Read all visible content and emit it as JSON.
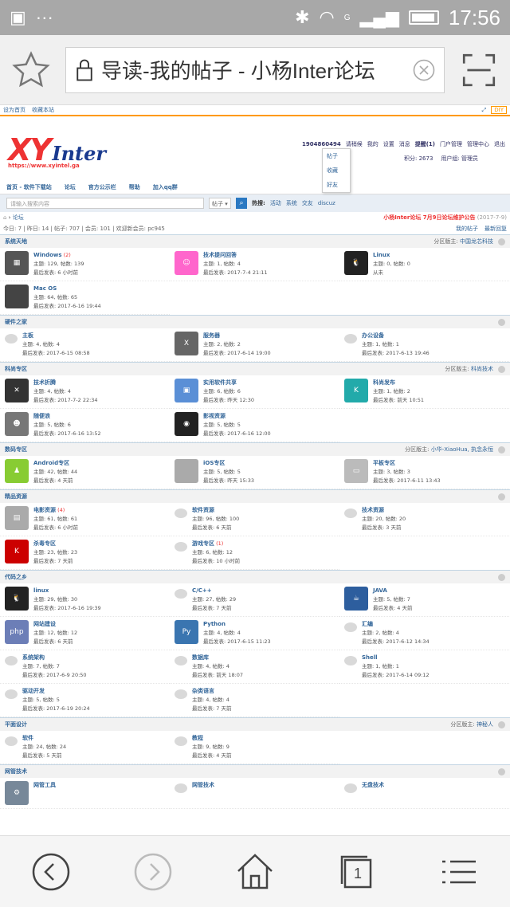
{
  "status": {
    "time": "17:56",
    "dots": "···",
    "net": "G"
  },
  "browser": {
    "title": "导读-我的帖子 - 小杨Inter论坛",
    "tab_count": "1"
  },
  "page": {
    "top_left": [
      "设为首页",
      "收藏本站"
    ],
    "top_right": "DIY",
    "logo": {
      "xy": "XY",
      "inter": "Inter",
      "url": "https://www.xyintel.ga"
    },
    "user": {
      "id": "1904860494",
      "items": [
        "请稍候",
        "我的",
        "设置",
        "消息",
        "提醒(1)",
        "门户管理",
        "管理中心",
        "退出"
      ],
      "points": "积分: 2673",
      "group": "用户组: 管理员"
    },
    "dropdown": [
      "帖子",
      "收藏",
      "好友"
    ],
    "nav": [
      "首页 - 软件下载站",
      "论坛",
      "官方公示栏",
      "帮助",
      "加入qq群"
    ],
    "search": {
      "placeholder": "请输入搜索内容",
      "type": "帖子",
      "hot_label": "热搜:",
      "hot": [
        "活动",
        "系统",
        "交友",
        "discuz"
      ]
    },
    "crumb": {
      "home": "论坛",
      "notice": "小杨Inter论坛 7月9日论坛维护公告",
      "date": "(2017-7-9)"
    },
    "stats": {
      "text": "今日: 7 | 昨日: 14 | 帖子: 707 | 会员: 101 | 欢迎新会员: pc945",
      "links": [
        "我的帖子",
        "最新回复"
      ]
    }
  },
  "sections": [
    {
      "name": "系统天地",
      "mod_label": "分区版主:",
      "mod": "中国龙芯科技",
      "forums": [
        {
          "icon": "win",
          "name": "Windows",
          "new": "(2)",
          "l1": "主题: 129, 帖数: 139",
          "l2": "最后发表: 6 小时前"
        },
        {
          "icon": "qa",
          "name": "技术提问回答",
          "new": "",
          "l1": "主题: 1, 帖数: 4",
          "l2": "最后发表: 2017-7-4 21:11"
        },
        {
          "icon": "linux",
          "name": "Linux",
          "new": "",
          "l1": "主题: 0, 帖数: 0",
          "l2": "从未"
        },
        {
          "icon": "mac",
          "name": "Mac OS",
          "new": "",
          "l1": "主题: 64, 帖数: 65",
          "l2": "最后发表: 2017-6-16 19:44"
        }
      ]
    },
    {
      "name": "硬件之家",
      "mod_label": "",
      "mod": "",
      "forums": [
        {
          "icon": "bubble",
          "name": "主板",
          "new": "",
          "l1": "主题: 4, 帖数: 4",
          "l2": "最后发表: 2017-6-15 08:58"
        },
        {
          "icon": "server",
          "name": "服务器",
          "new": "",
          "l1": "主题: 2, 帖数: 2",
          "l2": "最后发表: 2017-6-14 19:00"
        },
        {
          "icon": "bubble",
          "name": "办公设备",
          "new": "",
          "l1": "主题: 1, 帖数: 1",
          "l2": "最后发表: 2017-6-13 19:46"
        }
      ]
    },
    {
      "name": "科尚专区",
      "mod_label": "分区版主:",
      "mod": "科尚技术",
      "forums": [
        {
          "icon": "tools",
          "name": "技术折腾",
          "new": "",
          "l1": "主题: 4, 帖数: 4",
          "l2": "最后发表: 2017-7-2 22:34"
        },
        {
          "icon": "box",
          "name": "实用软件共享",
          "new": "",
          "l1": "主题: 6, 帖数: 6",
          "l2": "最后发表: 昨天 12:30"
        },
        {
          "icon": "keshang",
          "name": "科尚发布",
          "new": "",
          "l1": "主题: 1, 帖数: 2",
          "l2": "最后发表: 前天 10:51"
        },
        {
          "icon": "face",
          "name": "随便浪",
          "new": "",
          "l1": "主题: 5, 帖数: 6",
          "l2": "最后发表: 2017-6-16 13:52"
        },
        {
          "icon": "film",
          "name": "影视资源",
          "new": "",
          "l1": "主题: 5, 帖数: 5",
          "l2": "最后发表: 2017-6-16 12:00"
        }
      ]
    },
    {
      "name": "数码专区",
      "mod_label": "分区版主:",
      "mod": "小华-XiaoHua, 执念永恒",
      "forums": [
        {
          "icon": "android",
          "name": "Android专区",
          "new": "",
          "l1": "主题: 42, 帖数: 44",
          "l2": "最后发表: 4 天前"
        },
        {
          "icon": "ios",
          "name": "iOS专区",
          "new": "",
          "l1": "主题: 5, 帖数: 5",
          "l2": "最后发表: 昨天 15:33"
        },
        {
          "icon": "pad",
          "name": "平板专区",
          "new": "",
          "l1": "主题: 3, 帖数: 3",
          "l2": "最后发表: 2017-6-11 13:43"
        }
      ]
    },
    {
      "name": "精品资源",
      "mod_label": "",
      "mod": "",
      "forums": [
        {
          "icon": "movie",
          "name": "电影资源",
          "new": "(4)",
          "l1": "主题: 61, 帖数: 61",
          "l2": "最后发表: 6 小时前"
        },
        {
          "icon": "bubble",
          "name": "软件资源",
          "new": "",
          "l1": "主题: 96, 帖数: 100",
          "l2": "最后发表: 6 天前"
        },
        {
          "icon": "bubble",
          "name": "技术资源",
          "new": "",
          "l1": "主题: 20, 帖数: 20",
          "l2": "最后发表: 3 天前"
        },
        {
          "icon": "kav",
          "name": "杀毒专区",
          "new": "",
          "l1": "主题: 23, 帖数: 23",
          "l2": "最后发表: 7 天前"
        },
        {
          "icon": "bubble",
          "name": "游戏专区",
          "new": "(1)",
          "l1": "主题: 6, 帖数: 12",
          "l2": "最后发表: 10 小时前"
        }
      ]
    },
    {
      "name": "代码之乡",
      "mod_label": "",
      "mod": "",
      "forums": [
        {
          "icon": "linux",
          "name": "linux",
          "new": "",
          "l1": "主题: 29, 帖数: 30",
          "l2": "最后发表: 2017-6-16 19:39"
        },
        {
          "icon": "bubble",
          "name": "C/C++",
          "new": "",
          "l1": "主题: 27, 帖数: 29",
          "l2": "最后发表: 7 天前"
        },
        {
          "icon": "java",
          "name": "JAVA",
          "new": "",
          "l1": "主题: 5, 帖数: 7",
          "l2": "最后发表: 4 天前"
        },
        {
          "icon": "php",
          "name": "网站建设",
          "new": "",
          "l1": "主题: 12, 帖数: 12",
          "l2": "最后发表: 6 天前"
        },
        {
          "icon": "python",
          "name": "Python",
          "new": "",
          "l1": "主题: 4, 帖数: 4",
          "l2": "最后发表: 2017-6-15 11:23"
        },
        {
          "icon": "bubble",
          "name": "汇编",
          "new": "",
          "l1": "主题: 2, 帖数: 4",
          "l2": "最后发表: 2017-6-12 14:34"
        },
        {
          "icon": "bubble",
          "name": "系统架构",
          "new": "",
          "l1": "主题: 7, 帖数: 7",
          "l2": "最后发表: 2017-6-9 20:50"
        },
        {
          "icon": "bubble",
          "name": "数据库",
          "new": "",
          "l1": "主题: 4, 帖数: 4",
          "l2": "最后发表: 前天 18:07"
        },
        {
          "icon": "bubble",
          "name": "Shell",
          "new": "",
          "l1": "主题: 1, 帖数: 1",
          "l2": "最后发表: 2017-6-14 09:12"
        },
        {
          "icon": "bubble",
          "name": "驱动开发",
          "new": "",
          "l1": "主题: 5, 帖数: 5",
          "l2": "最后发表: 2017-6-19 20:24"
        },
        {
          "icon": "bubble",
          "name": "杂类语言",
          "new": "",
          "l1": "主题: 4, 帖数: 4",
          "l2": "最后发表: 7 天前"
        }
      ]
    },
    {
      "name": "平面设计",
      "mod_label": "分区版主:",
      "mod": "神秘人",
      "forums": [
        {
          "icon": "bubble",
          "name": "软件",
          "new": "",
          "l1": "主题: 24, 帖数: 24",
          "l2": "最后发表: 5 天前"
        },
        {
          "icon": "bubble",
          "name": "教程",
          "new": "",
          "l1": "主题: 9, 帖数: 9",
          "l2": "最后发表: 4 天前"
        }
      ]
    },
    {
      "name": "网管技术",
      "mod_label": "",
      "mod": "",
      "forums": [
        {
          "icon": "tool",
          "name": "网管工具",
          "new": "",
          "l1": "",
          "l2": ""
        },
        {
          "icon": "bubble",
          "name": "网管技术",
          "new": "",
          "l1": "",
          "l2": ""
        },
        {
          "icon": "bubble",
          "name": "无盘技术",
          "new": "",
          "l1": "",
          "l2": ""
        }
      ]
    }
  ]
}
